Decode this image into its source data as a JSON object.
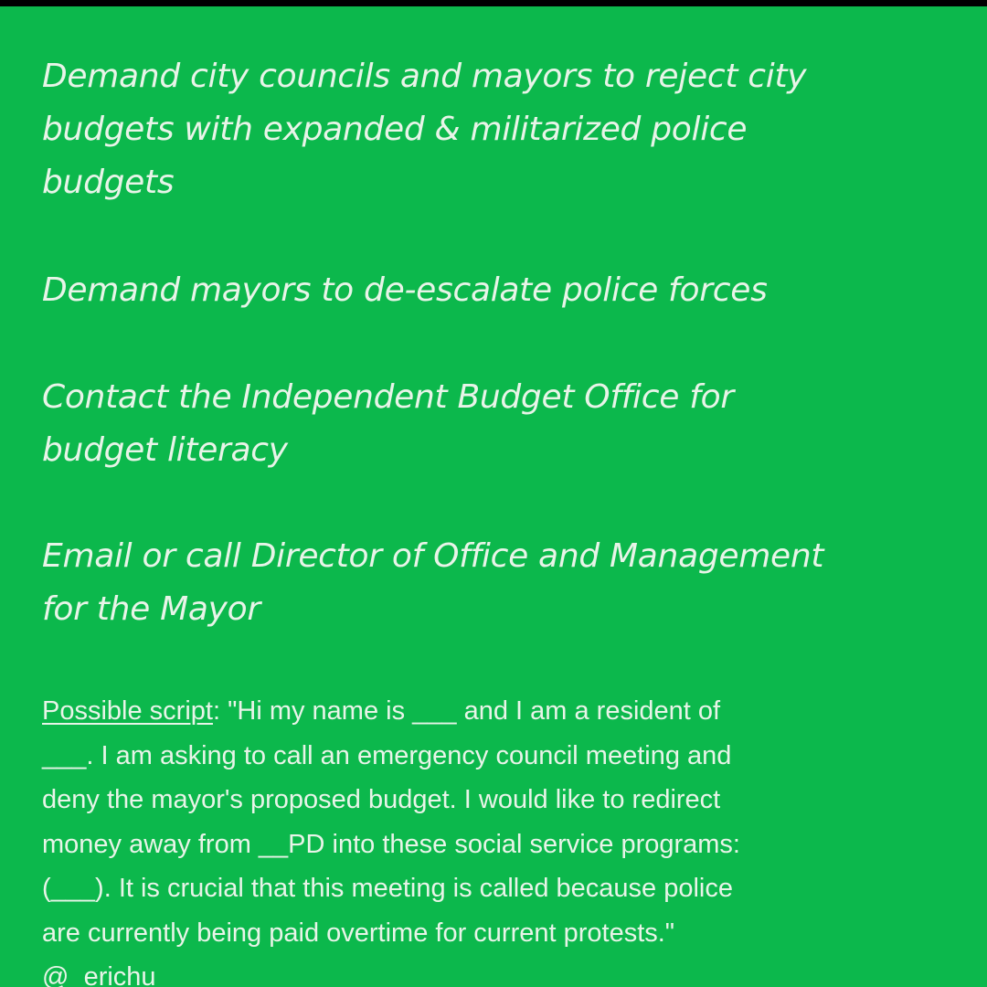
{
  "background_color": "#0cb84c",
  "text_color": "#e8f4e8",
  "items": [
    {
      "lines": [
        "Demand city councils and mayors to reject city",
        "budgets with expanded & militarized police",
        "budgets"
      ]
    },
    {
      "lines": [
        "Demand mayors to de-escalate police forces"
      ]
    },
    {
      "lines": [
        "Contact the Independent Budget Office for",
        "budget literacy"
      ]
    },
    {
      "lines": [
        "Email or call Director of Office and Management",
        "for the Mayor"
      ]
    }
  ],
  "script": {
    "label": "Possible script",
    "first_line_rest": ": \"Hi my name is ___ and I am a resident of",
    "lines": [
      "___. I am asking to call an emergency council meeting and",
      "deny the mayor's proposed budget. I would like to redirect",
      "money away from __PD into these social service programs:",
      "(___). It is crucial that this meeting is called because police",
      "are currently being paid overtime for current protests.\"",
      "@_erichu"
    ]
  }
}
